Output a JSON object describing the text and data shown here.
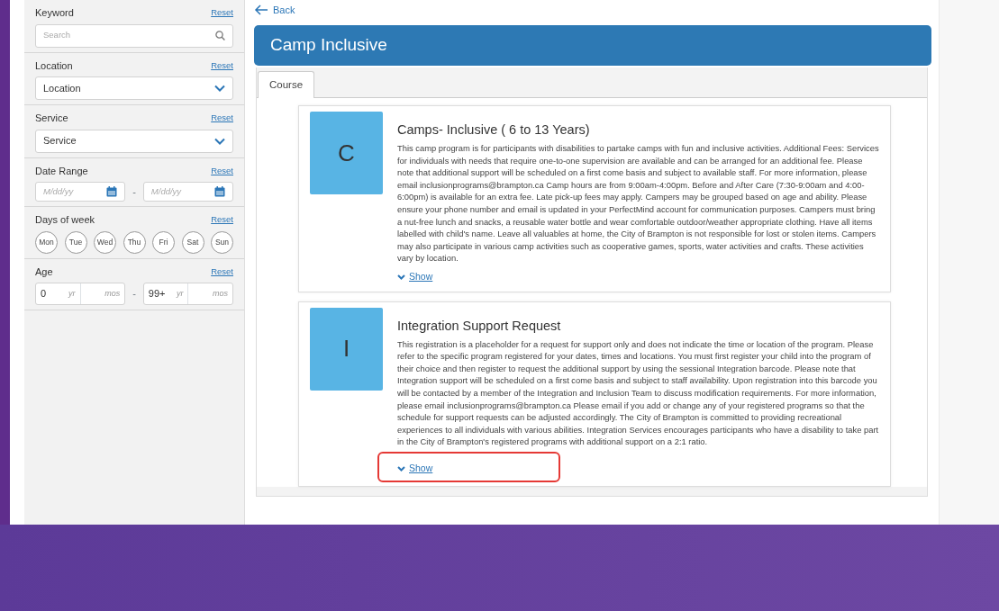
{
  "sidebar": {
    "sections": [
      {
        "kind": "search",
        "label": "Keyword",
        "reset": "Reset",
        "placeholder": "Search"
      },
      {
        "kind": "select",
        "label": "Location",
        "reset": "Reset",
        "value": "Location"
      },
      {
        "kind": "select",
        "label": "Service",
        "reset": "Reset",
        "value": "Service"
      },
      {
        "kind": "daterange",
        "label": "Date Range",
        "reset": "Reset",
        "separator": "-",
        "from_placeholder": "M/dd/yy",
        "to_placeholder": "M/dd/yy"
      },
      {
        "kind": "days",
        "label": "Days of week",
        "reset": "Reset",
        "days": [
          {
            "label": "Mon",
            "selected": false
          },
          {
            "label": "Tue",
            "selected": false
          },
          {
            "label": "Wed",
            "selected": false
          },
          {
            "label": "Thu",
            "selected": false
          },
          {
            "label": "Fri",
            "selected": false
          },
          {
            "label": "Sat",
            "selected": false
          },
          {
            "label": "Sun",
            "selected": false
          }
        ]
      },
      {
        "kind": "age",
        "label": "Age",
        "reset": "Reset",
        "separator": "-",
        "from_years": "0",
        "from_years_unit": "yr",
        "from_months_unit": "mos",
        "to_years": "99+",
        "to_years_unit": "yr",
        "to_months_unit": "mos"
      }
    ]
  },
  "back_link": "Back",
  "title": "Camp Inclusive",
  "tabs": [
    {
      "label": "Course",
      "selected": true
    }
  ],
  "courses": [
    {
      "initial": "C",
      "title": "Camps- Inclusive ( 6 to 13 Years)",
      "description": "This camp program is for participants with disabilities to partake camps with fun and inclusive activities. Additional Fees: Services for individuals with needs that require one-to-one supervision are available and can be arranged for an additional fee. Please note that additional support will be scheduled on a first come basis and subject to available staff. For more information, please email inclusionprograms@brampton.ca Camp hours are from 9:00am-4:00pm. Before and After Care (7:30-9:00am and 4:00-6:00pm) is available for an extra fee. Late pick-up fees may apply. Campers may be grouped based on age and ability. Please ensure your phone number and email is updated in your PerfectMind account for communication purposes. Campers must bring a nut-free lunch and snacks, a reusable water bottle and wear comfortable outdoor/weather appropriate clothing. Have all items labelled with child's name. Leave all valuables at home, the City of Brampton is not responsible for lost or stolen items. Campers may also participate in various camp activities such as cooperative games, sports, water activities and crafts. These activities vary by location.",
      "show": "Show",
      "highlighted": false
    },
    {
      "initial": "I",
      "title": "Integration Support Request",
      "description": "This registration is a placeholder for a request for support only and does not indicate the time or location of the program. Please refer to the specific program registered for your dates, times and locations. You must first register your child into the program of their choice and then register to request the additional support by using the sessional Integration barcode. Please note that Integration support will be scheduled on a first come basis and subject to staff availability. Upon registration into this barcode you will be contacted by a member of the Integration and Inclusion Team to discuss modification requirements. For more information, please email inclusionprograms@brampton.ca Please email if you add or change any of your registered programs so that the schedule for support requests can be adjusted accordingly. The City of Brampton is committed to providing recreational experiences to all individuals with various abilities. Integration Services encourages participants who have a disability to take part in the City of Brampton's registered programs with additional support on a 2:1 ratio.",
      "show": "Show",
      "highlighted": true
    }
  ]
}
